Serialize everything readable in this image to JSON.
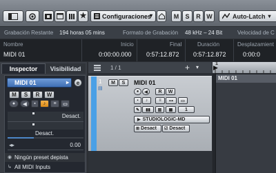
{
  "toolbar": {
    "config_label": "Configuraciones",
    "btn_m": "M",
    "btn_s": "S",
    "btn_r": "R",
    "btn_w": "W",
    "auto_label": "Auto-Latch"
  },
  "status": {
    "rec_label": "Grabación Restante",
    "rec_value": "194 horas 05 mins",
    "fmt_label": "Formato de Grabación",
    "fmt_value": "48 kHz – 24 Bit",
    "speed_label": "Velocidad de C"
  },
  "infoline": {
    "headers": [
      "Nombre",
      "Inicio",
      "Final",
      "Duración",
      "Desplazamient"
    ],
    "values": [
      "MIDI 01",
      "0:00:00.000",
      "0:57:12.872",
      "0:57:12.872",
      "0:00:0"
    ]
  },
  "inspector": {
    "tab_inspector": "Inspector",
    "tab_visibility": "Visibilidad",
    "track_name": "MIDI 01",
    "btn_m": "M",
    "btn_s": "S",
    "btn_r": "R",
    "btn_w": "W",
    "desact1": "Desact.",
    "desact2": "Desact.",
    "value": "0.00",
    "preset": "Ningún preset depista",
    "midi_inputs": "All MIDI Inputs"
  },
  "tracklist": {
    "page": "1 / 1",
    "track_number": "1",
    "track_name": "MIDI 01",
    "btn_m": "M",
    "btn_s": "S",
    "btn_r": "R",
    "btn_w": "W",
    "channel": "1",
    "output": "STUDIOLOGIC-MD",
    "desact_a": "Desact",
    "desact_b": "Desact"
  },
  "arrange": {
    "ruler_mark": "1",
    "part_name": "MIDI 01"
  },
  "colors": {
    "accent_blue": "#4aa0e6",
    "record_orange": "#e89a2a"
  }
}
